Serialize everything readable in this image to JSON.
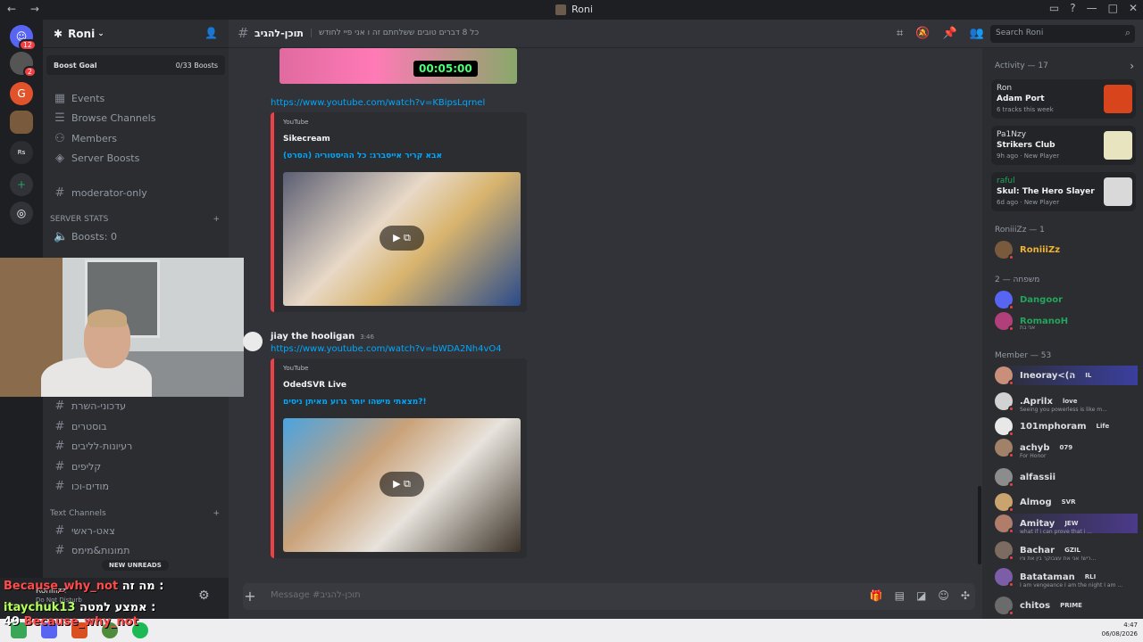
{
  "window": {
    "title": "Roni"
  },
  "server": {
    "name": "Roni",
    "boost_goal": "Boost Goal",
    "boost_count": "0/33 Boosts"
  },
  "guild_badges": {
    "home": "12",
    "second": "2"
  },
  "channels": {
    "events": "Events",
    "browse": "Browse Channels",
    "members": "Members",
    "boosts": "Server Boosts",
    "moderator": "moderator-only",
    "stats_cat": "SERVER STATS",
    "boosts_count": "Boosts: 0",
    "ch_updates": "עדכוני-השרת",
    "ch_boosters": "בוסטרים",
    "ch_ideas": "רעיונות-לליבים",
    "ch_clips": "קליפים",
    "ch_thanks": "מודים-וכו",
    "text_cat": "Text Channels",
    "ch_main": "צאט-ראשי",
    "ch_media": "תמונות&מימס",
    "new_unreads": "NEW UNREADS"
  },
  "user_panel": {
    "name": "Roniiizz",
    "status": "Do Not Disturb"
  },
  "overlay": {
    "line1_user": "Because_why_not",
    "line1_text": "מה זה :",
    "line2_user": "itaychuk13",
    "line2_text": "אמצע למטה :",
    "count": "49",
    "line3_user": "Because_why_not"
  },
  "header": {
    "channel": "תוכן-להגיב",
    "topic": "כל 8 דברים טובים ששלחתם זה ו אני פיי לחודש",
    "search_placeholder": "Search Roni"
  },
  "messages": {
    "timer": "00:05:00",
    "link1": "https://www.youtube.com/watch?v=KBipsLqrnel",
    "embed1_src": "YouTube",
    "embed1_author": "Sikecream",
    "embed1_title": "אבא קריר אייסברג: כל ההיסטוריה (הסרט)",
    "author": "jiay the hooligan",
    "time": "3:46",
    "link2": "https://www.youtube.com/watch?v=bWDA2Nh4vO4",
    "embed2_src": "YouTube",
    "embed2_author": "OdedSVR Live",
    "embed2_title": "מצאתי מישהו יותר גרוע מאיתן ניסים?!"
  },
  "composer": {
    "placeholder": "Message #תוכן-להגיב"
  },
  "members": {
    "activity_header": "Activity — 17",
    "activities": [
      {
        "name": "Ron",
        "title": "Adam Port",
        "sub": "6 tracks this week",
        "color": "#d8441c"
      },
      {
        "name": "Pa1Nzy",
        "title": "Strikers Club",
        "sub": "9h ago · New Player",
        "color": "#e8e4c0"
      },
      {
        "name": "raful",
        "title": "Skul: The Hero Slayer",
        "sub": "6d ago · New Player",
        "color": "#d9d9d9"
      }
    ],
    "g1_header": "RoniiiZz — 1",
    "g1_member": "RoniiiZz",
    "g2_header": "משפחה — 2",
    "g2_m1": "Dangoor",
    "g2_m2": "RomanoH",
    "g2_m2_sub": "אני בת",
    "g3_header": "Member — 53",
    "list": [
      {
        "name": "Ineoray<(ה",
        "tag": "IL",
        "sub": "",
        "color": "#ffffff",
        "av": "#c98f7a"
      },
      {
        "name": ".Aprilx",
        "tag": "love",
        "sub": "Seeing you powerless is like m...",
        "color": "#ffffff",
        "av": "#d2d2d2"
      },
      {
        "name": "101mphoram",
        "tag": "Life",
        "sub": "",
        "color": "#ffffff",
        "av": "#e8e8e8"
      },
      {
        "name": "achyb",
        "tag": "079",
        "sub": "For Honor",
        "color": "#ffffff",
        "av": "#a18268"
      },
      {
        "name": "alfassii",
        "tag": "",
        "sub": "",
        "color": "#ffffff",
        "av": "#8c8c8c"
      },
      {
        "name": "Almog",
        "tag": "SVR",
        "sub": "",
        "color": "#ffffff",
        "av": "#c9a46e"
      },
      {
        "name": "Amitay",
        "tag": "JEW",
        "sub": "what if i can prove that i ...",
        "color": "#ffffff",
        "av": "#b07d6b"
      },
      {
        "name": "Bachar",
        "tag": "GZIL",
        "sub": "ריש! אני את עצבוקר בין את ציו...",
        "color": "#ffffff",
        "av": "#7b6b60"
      },
      {
        "name": "Batataman",
        "tag": "RLI",
        "sub": "I am vengeance I am the night I am ...",
        "color": "#ffffff",
        "av": "#7b5ea7"
      },
      {
        "name": "chitos",
        "tag": "PRIME",
        "sub": "",
        "color": "#ffffff",
        "av": "#6b6b6b"
      }
    ]
  },
  "taskbar": {
    "time": "4:47",
    "date": "06/08/2026"
  }
}
